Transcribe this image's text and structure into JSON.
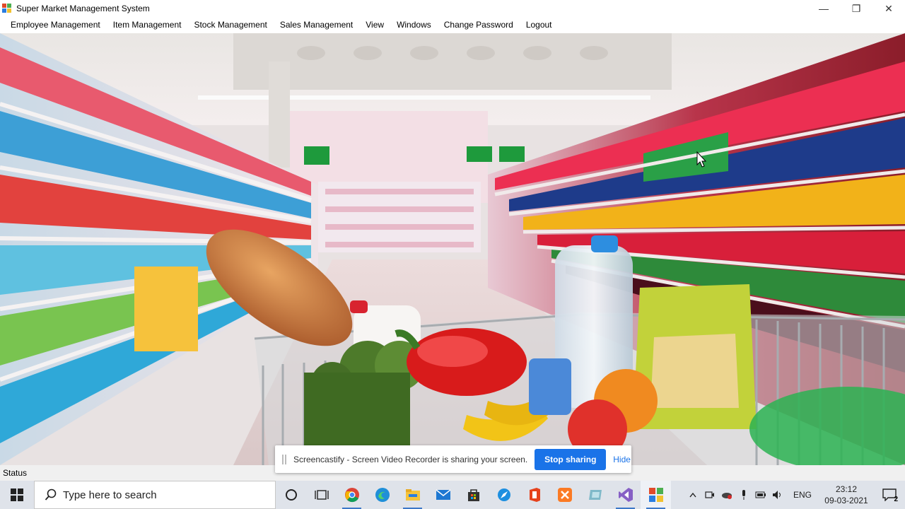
{
  "window": {
    "title": "Super Market Management System",
    "controls": {
      "minimize": "—",
      "maximize": "❐",
      "close": "✕"
    }
  },
  "menu": {
    "items": [
      "Employee Management",
      "Item Management",
      "Stock Management",
      "Sales Management",
      "View",
      "Windows",
      "Change Password",
      "Logout"
    ]
  },
  "status": {
    "label": "Status"
  },
  "share_banner": {
    "message": "Screencastify - Screen Video Recorder is sharing your screen.",
    "stop_label": "Stop sharing",
    "hide_label": "Hide"
  },
  "taskbar": {
    "search_placeholder": "Type here to search",
    "pinned_icons": [
      "cortana-icon",
      "task-view-icon",
      "chrome-icon",
      "edge-icon",
      "file-explorer-icon",
      "mail-icon",
      "store-icon",
      "safari-icon",
      "office-icon",
      "xampp-icon",
      "app-icon",
      "visual-studio-icon",
      "winforms-app-icon"
    ],
    "language": "ENG",
    "time": "23:12",
    "date": "09-03-2021",
    "notification_count": "2"
  },
  "colors": {
    "stop_button": "#1a73e8",
    "taskbar_bg": "#dfe3ea",
    "status_bg": "#f0f0f0"
  }
}
